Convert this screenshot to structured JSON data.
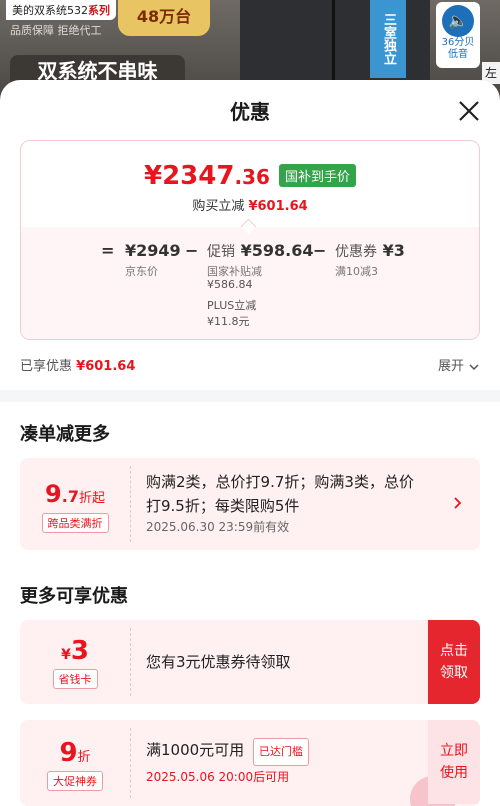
{
  "background": {
    "brand_prefix": "美的双系统532",
    "brand_suffix": "系列",
    "quality": "品质保障 拒绝代工",
    "promo": "48万台",
    "slogan": "双系统不串味",
    "door_label": "三室独立",
    "noise_value": "36分贝",
    "noise_label": "低音",
    "edge_text": "左"
  },
  "sheet": {
    "title": "优惠"
  },
  "price_card": {
    "currency": "¥",
    "price_int": "2347",
    "price_dec": ".36",
    "tag": "国补到手价",
    "buy_label": "购买立减",
    "buy_amount": "¥601.64",
    "equals": "=",
    "minus1": "−",
    "minus2": "−",
    "jd_price": "¥2949",
    "jd_label": "京东价",
    "promo_label": "促销",
    "promo_amount": "¥598.64",
    "subsidy_label": "国家补贴减",
    "subsidy_amount": "¥586.84",
    "plus_label": "PLUS立减",
    "plus_amount": "¥11.8元",
    "coupon_label": "优惠券",
    "coupon_amount": "¥3",
    "coupon_rule": "满10减3"
  },
  "summary": {
    "enjoyed_label": "已享优惠",
    "enjoyed_amount": "¥601.64",
    "expand_label": "展开"
  },
  "section1": {
    "title": "凑单减更多"
  },
  "offer1": {
    "value_big": "9",
    "value_small": ".7",
    "value_unit": "折起",
    "badge": "跨品类满折",
    "desc_line1": "购满2类，总价打9.7折；购满3类，总价",
    "desc_line2": "打9.5折；每类限购5件",
    "date": "2025.06.30  23:59前有效"
  },
  "section2": {
    "title": "更多可享优惠"
  },
  "offer2": {
    "currency": "¥",
    "value_big": "3",
    "badge": "省钱卡",
    "desc": "您有3元优惠券待领取",
    "action_line1": "点击",
    "action_line2": "领取"
  },
  "offer3": {
    "value_big": "9",
    "value_unit": "折",
    "badge": "大促神券",
    "desc": "满1000元可用",
    "status_pill": "已达门槛",
    "date": "2025.05.06  20:00后可用",
    "action_line1": "立即",
    "action_line2": "使用"
  },
  "colors": {
    "accent_red": "#e8141e",
    "subsidy_green": "#33a44a",
    "card_bg": "#fff0f2"
  },
  "icons": {
    "close": "close-icon",
    "expand": "chevron-down-icon",
    "offer_arrow": "chevron-right-icon"
  }
}
